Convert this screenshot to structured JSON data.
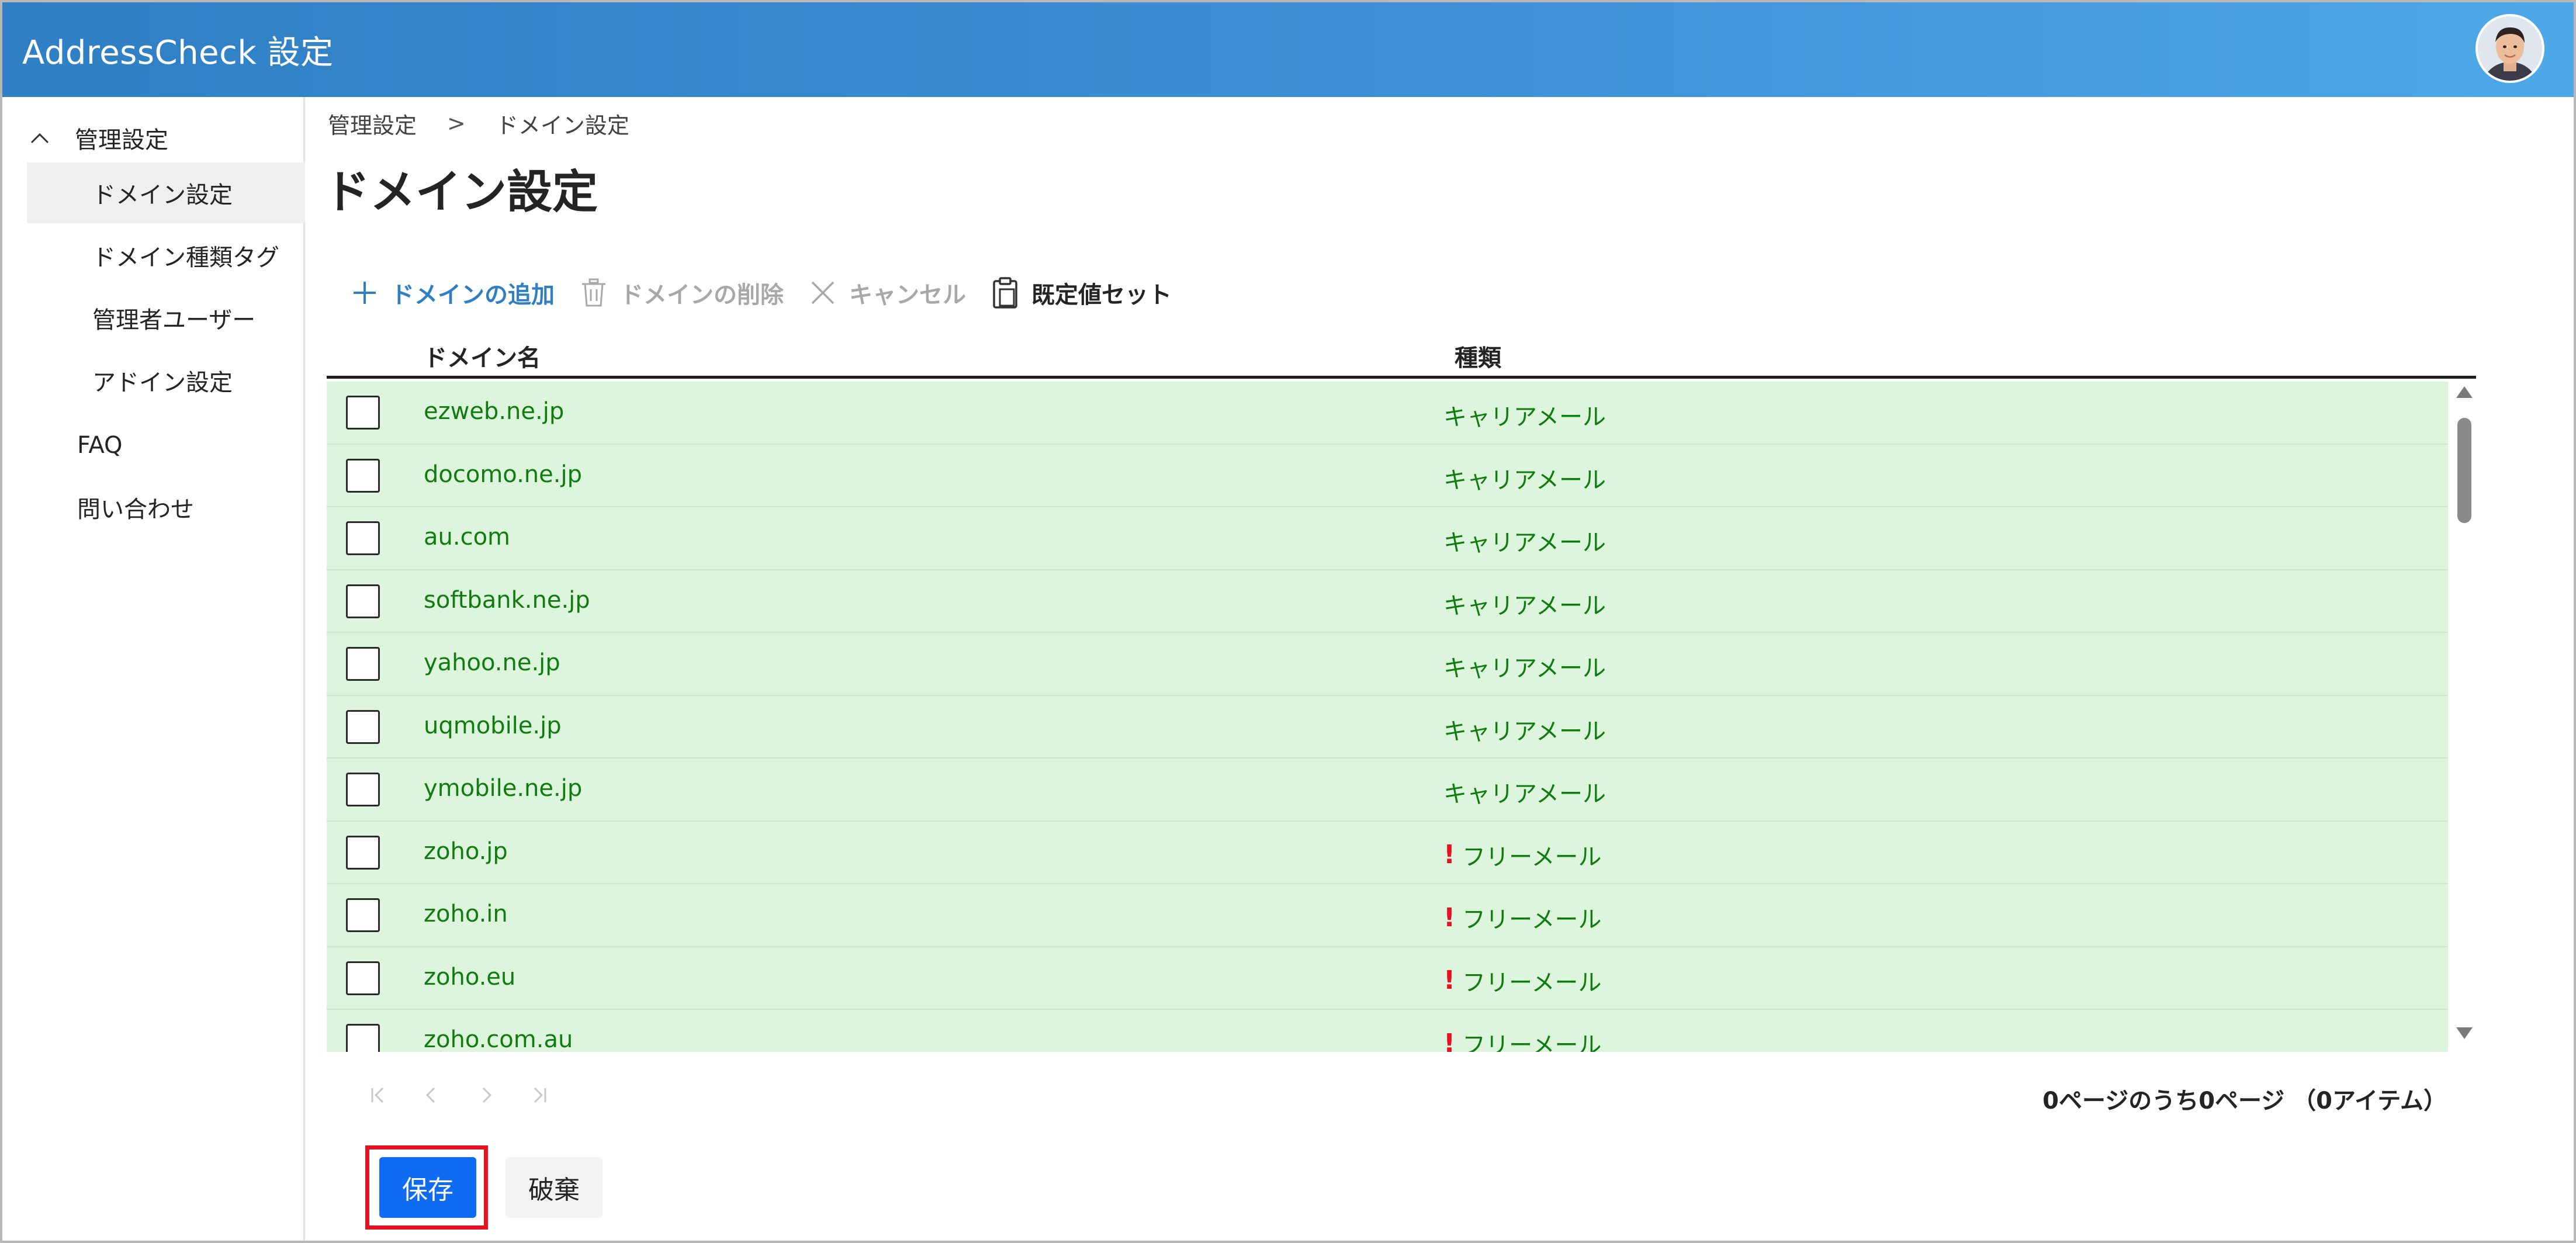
{
  "header": {
    "title": "AddressCheck 設定"
  },
  "sidebar": {
    "group_label": "管理設定",
    "children": [
      {
        "label": "ドメイン設定",
        "active": true
      },
      {
        "label": "ドメイン種類タグ"
      },
      {
        "label": "管理者ユーザー"
      },
      {
        "label": "アドイン設定"
      }
    ],
    "top_items": [
      {
        "label": "FAQ"
      },
      {
        "label": "問い合わせ"
      }
    ]
  },
  "breadcrumb": {
    "parent": "管理設定",
    "separator": ">",
    "current": "ドメイン設定"
  },
  "page": {
    "title": "ドメイン設定"
  },
  "toolbar": {
    "add_label": "ドメインの追加",
    "delete_label": "ドメインの削除",
    "cancel_label": "キャンセル",
    "preset_label": "既定値セット"
  },
  "grid": {
    "columns": {
      "name": "ドメイン名",
      "type": "種類"
    },
    "rows": [
      {
        "name": "ezweb.ne.jp",
        "type": "キャリアメール",
        "warn": ""
      },
      {
        "name": "docomo.ne.jp",
        "type": "キャリアメール",
        "warn": ""
      },
      {
        "name": "au.com",
        "type": "キャリアメール",
        "warn": ""
      },
      {
        "name": "softbank.ne.jp",
        "type": "キャリアメール",
        "warn": ""
      },
      {
        "name": "yahoo.ne.jp",
        "type": "キャリアメール",
        "warn": ""
      },
      {
        "name": "uqmobile.jp",
        "type": "キャリアメール",
        "warn": ""
      },
      {
        "name": "ymobile.ne.jp",
        "type": "キャリアメール",
        "warn": ""
      },
      {
        "name": "zoho.jp",
        "type": "フリーメール",
        "warn": "!"
      },
      {
        "name": "zoho.in",
        "type": "フリーメール",
        "warn": "!"
      },
      {
        "name": "zoho.eu",
        "type": "フリーメール",
        "warn": "!"
      },
      {
        "name": "zoho.com.au",
        "type": "フリーメール",
        "warn": "!"
      }
    ]
  },
  "pager": {
    "text": "0ページのうち0ページ （0アイテム）"
  },
  "actions": {
    "save_label": "保存",
    "discard_label": "破棄"
  },
  "colors": {
    "header_start": "#2f7fc5",
    "header_end": "#4ea8e8",
    "row_bg": "#ddf5dc",
    "row_text": "#107c10",
    "primary": "#0f6cf2",
    "highlight": "#e81123",
    "warn": "#e81123"
  }
}
